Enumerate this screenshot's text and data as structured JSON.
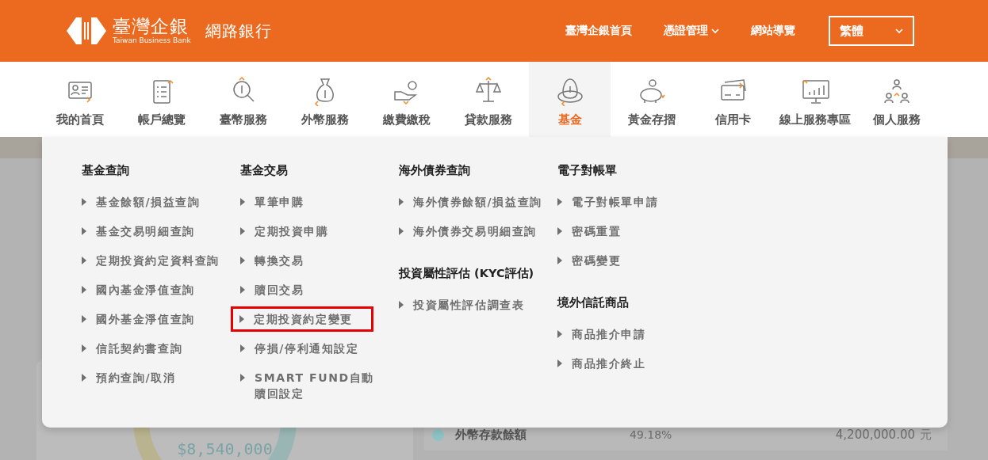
{
  "header": {
    "logo_name": "臺灣企銀",
    "logo_english": "Taiwan Business Bank",
    "site_title": "網路銀行",
    "links": [
      {
        "label": "臺灣企銀首頁",
        "has_caret": false
      },
      {
        "label": "憑證管理",
        "has_caret": true
      },
      {
        "label": "網站導覽",
        "has_caret": false
      }
    ],
    "language_select": {
      "value": "繁體"
    }
  },
  "nav": {
    "items": [
      {
        "label": "我的首頁",
        "selected": false
      },
      {
        "label": "帳戶總覽",
        "selected": false
      },
      {
        "label": "臺幣服務",
        "selected": false
      },
      {
        "label": "外幣服務",
        "selected": false
      },
      {
        "label": "繳費繳稅",
        "selected": false
      },
      {
        "label": "貸款服務",
        "selected": false
      },
      {
        "label": "基金",
        "selected": true
      },
      {
        "label": "黃金存摺",
        "selected": false
      },
      {
        "label": "信用卡",
        "selected": false
      },
      {
        "label": "線上服務專區",
        "selected": false
      },
      {
        "label": "個人服務",
        "selected": false
      }
    ]
  },
  "menu": {
    "columns": [
      {
        "sections": [
          {
            "title": "基金查詢",
            "items": [
              {
                "label": "基金餘額/損益查詢",
                "highlighted": false
              },
              {
                "label": "基金交易明細查詢",
                "highlighted": false
              },
              {
                "label": "定期投資約定資料查詢",
                "highlighted": false
              },
              {
                "label": "國內基金淨值查詢",
                "highlighted": false
              },
              {
                "label": "國外基金淨值查詢",
                "highlighted": false
              },
              {
                "label": "信託契約書查詢",
                "highlighted": false
              },
              {
                "label": "預約查詢/取消",
                "highlighted": false
              }
            ]
          }
        ]
      },
      {
        "sections": [
          {
            "title": "基金交易",
            "items": [
              {
                "label": "單筆申購",
                "highlighted": false
              },
              {
                "label": "定期投資申購",
                "highlighted": false
              },
              {
                "label": "轉換交易",
                "highlighted": false
              },
              {
                "label": "贖回交易",
                "highlighted": false
              },
              {
                "label": "定期投資約定變更",
                "highlighted": true
              },
              {
                "label": "停損/停利通知設定",
                "highlighted": false
              },
              {
                "label": "SMART FUND自動贖回設定",
                "highlighted": false
              }
            ]
          }
        ]
      },
      {
        "sections": [
          {
            "title": "海外債券查詢",
            "items": [
              {
                "label": "海外債券餘額/損益查詢",
                "highlighted": false
              },
              {
                "label": "海外債券交易明細查詢",
                "highlighted": false
              }
            ]
          },
          {
            "title": "投資屬性評估 (KYC評估)",
            "items": [
              {
                "label": "投資屬性評估調查表",
                "highlighted": false
              }
            ]
          }
        ]
      },
      {
        "sections": [
          {
            "title": "電子對帳單",
            "items": [
              {
                "label": "電子對帳單申請",
                "highlighted": false
              },
              {
                "label": "密碼重置",
                "highlighted": false
              },
              {
                "label": "密碼變更",
                "highlighted": false
              }
            ]
          },
          {
            "title": "境外信託商品",
            "items": [
              {
                "label": "商品推介申請",
                "highlighted": false
              },
              {
                "label": "商品推介終止",
                "highlighted": false
              }
            ]
          }
        ]
      }
    ]
  },
  "background": {
    "total": "$8,540,000",
    "rows": [
      {
        "name": "外幣存款餘額",
        "share": "49.18%",
        "amount": "4,200,000.00",
        "unit": "元",
        "color": "#8cc3c4"
      }
    ]
  }
}
